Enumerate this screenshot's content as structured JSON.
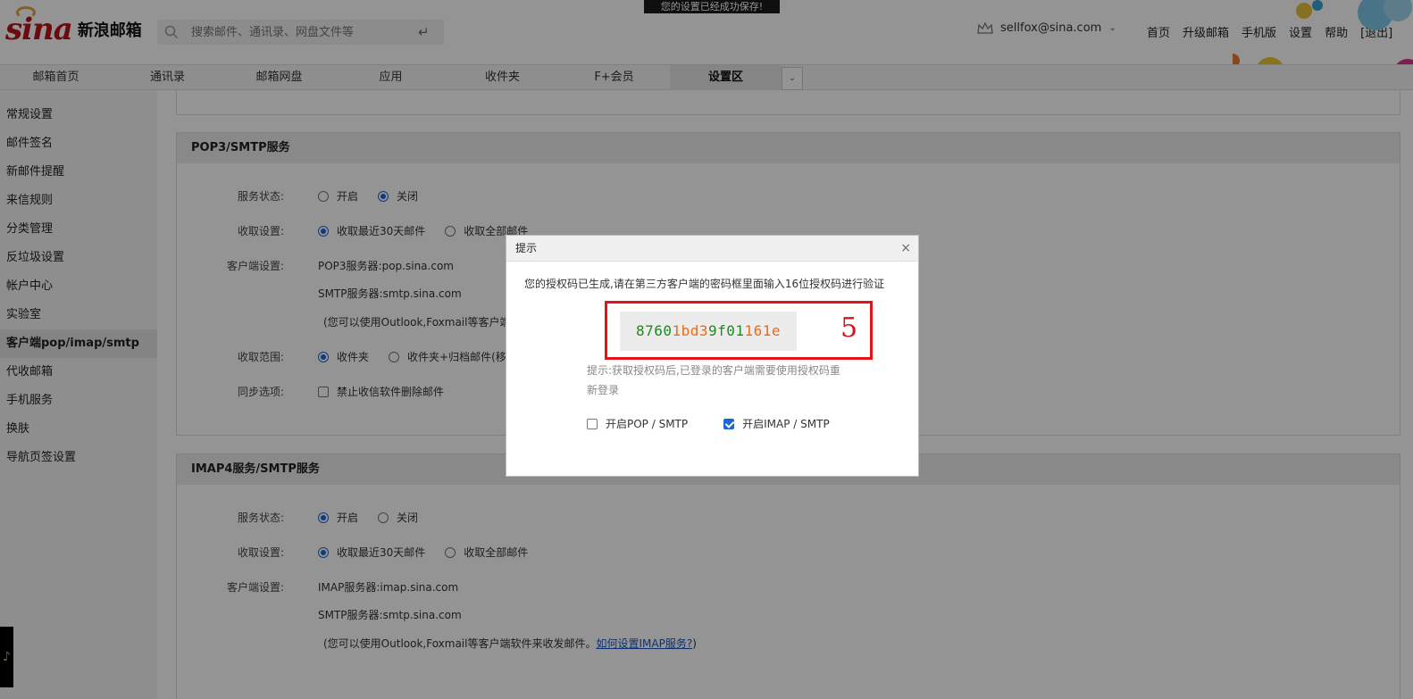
{
  "header": {
    "toast": "您的设置已经成功保存!",
    "logo_mark": "sina",
    "logo_text": "新浪邮箱",
    "search_placeholder": "搜索邮件、通讯录、网盘文件等",
    "user_email": "sellfox@sina.com",
    "links": [
      "首页",
      "升级邮箱",
      "手机版",
      "设置",
      "帮助",
      "[退出]"
    ]
  },
  "tabs": [
    {
      "label": "邮箱首页"
    },
    {
      "label": "通讯录"
    },
    {
      "label": "邮箱网盘"
    },
    {
      "label": "应用"
    },
    {
      "label": "收件夹"
    },
    {
      "label": "F+会员"
    },
    {
      "label": "设置区",
      "active": true
    }
  ],
  "sidebar": {
    "items": [
      "常规设置",
      "邮件签名",
      "新邮件提醒",
      "来信规则",
      "分类管理",
      "反垃圾设置",
      "帐户中心",
      "实验室",
      "客户端pop/imap/smtp",
      "代收邮箱",
      "手机服务",
      "换肤",
      "导航页签设置"
    ],
    "active_index": 8,
    "music_icon": "music-note-icon"
  },
  "pop3": {
    "title": "POP3/SMTP服务",
    "status_label": "服务状态:",
    "status_on": "开启",
    "status_off": "关闭",
    "recv_label": "收取设置:",
    "recv_30": "收取最近30天邮件",
    "recv_all": "收取全部邮件",
    "client_label": "客户端设置:",
    "pop_server": "POP3服务器:pop.sina.com",
    "smtp_server": "SMTP服务器:smtp.sina.com",
    "client_note": "(您可以使用Outlook,Foxmail等客户端软件来收发邮件。",
    "range_label": "收取范围:",
    "range_inbox": "收件夹",
    "range_archive": "收件夹+归档邮件(移动",
    "sync_label": "同步选项:",
    "sync_delete": "禁止收信软件删除邮件"
  },
  "imap": {
    "title": "IMAP4服务/SMTP服务",
    "status_label": "服务状态:",
    "status_on": "开启",
    "status_off": "关闭",
    "recv_label": "收取设置:",
    "recv_30": "收取最近30天邮件",
    "recv_all": "收取全部邮件",
    "client_label": "客户端设置:",
    "imap_server": "IMAP服务器:imap.sina.com",
    "smtp_server": "SMTP服务器:smtp.sina.com",
    "client_note": "(您可以使用Outlook,Foxmail等客户端软件来收发邮件。",
    "help_link": "如何设置IMAP服务?",
    "client_note_end": ")"
  },
  "dialog": {
    "title": "提示",
    "close": "×",
    "message": "您的授权码已生成,请在第三方客户端的密码框里面输入16位授权码进行验证",
    "code_parts": [
      {
        "text": "8760",
        "color": "green"
      },
      {
        "text": "1bd3",
        "color": "orange"
      },
      {
        "text": "9f01",
        "color": "green"
      },
      {
        "text": "161e",
        "color": "orange"
      }
    ],
    "annotation": "5",
    "tip": "提示:获取授权码后,已登录的客户端需要使用授权码重新登录",
    "opt_pop": "开启POP / SMTP",
    "opt_imap": "开启IMAP / SMTP"
  },
  "colors": {
    "accent": "#1a66d9",
    "brand": "#b8141b",
    "highlight_frame": "#e2131b",
    "code_green": "#1d8b1d",
    "code_orange": "#ef6a12"
  }
}
